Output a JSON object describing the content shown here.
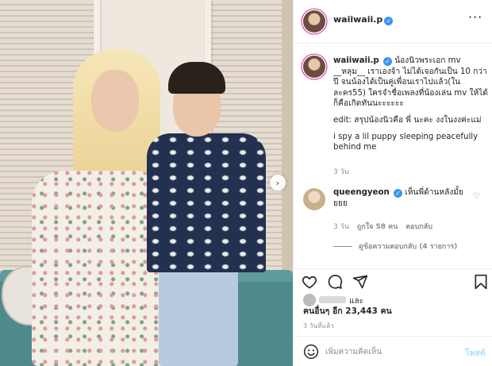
{
  "post": {
    "username": "waiiwaii.p",
    "more_icon": "more-horizontal-icon",
    "verified_icon": "verified-badge-icon"
  },
  "caption": {
    "username": "waiiwaii.p",
    "line1": "น้องนิวพระเอก mv __หลุม__ เราเองจ้า   ไม่ได้เจอกันเป็น 10 กว่าปี จนน้องได้เป็นคู่เพื่อนเราไปแล้ว(ในละคร55) ใครจำชื่อเพลงที่น้องเล่น mv ให้ได้ก็คือเกิดทันนะะะะะะ",
    "line2": "edit: สรุปน้องนิวคือ พี่ นะคะ งงในงงค่ะแม่",
    "line3": "i spy a lil puppy sleeping peacefully behind me",
    "time": "3 วัน"
  },
  "comment": {
    "username": "queengyeon",
    "text": "เห็นพี่ด้านหลังมั้ยยยย",
    "time": "3 วัน",
    "likes": "ถูกใจ 58 คน",
    "reply_label": "ตอบกลับ",
    "view_replies": "ดูข้อความตอบกลับ (4 รายการ)"
  },
  "likes": {
    "and_label": "และ",
    "summary": "คนอื่นๆ อีก 23,443 คน"
  },
  "post_time": "3 วันที่แล้ว",
  "composer": {
    "placeholder": "เพิ่มความคิดเห็น",
    "post_label": "โพสต์"
  },
  "colors": {
    "verified": "#3897f0",
    "post_button_disabled": "#b2dffc",
    "muted_text": "#8e8e8e"
  },
  "icons": [
    "heart-icon",
    "comment-icon",
    "share-icon",
    "bookmark-icon",
    "emoji-icon",
    "carousel-next-icon"
  ]
}
